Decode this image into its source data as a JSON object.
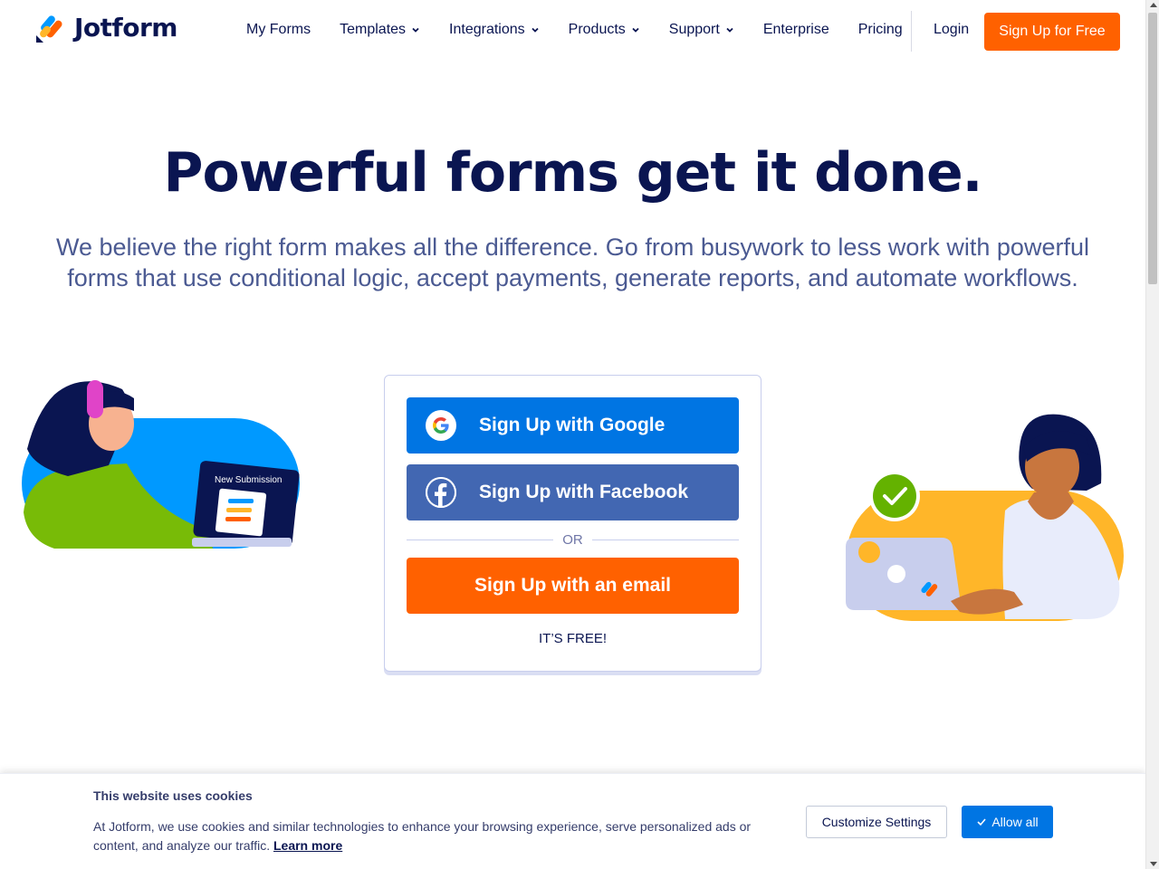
{
  "header": {
    "logo_text": "Jotform",
    "nav": [
      {
        "label": "My Forms",
        "dropdown": false
      },
      {
        "label": "Templates",
        "dropdown": true
      },
      {
        "label": "Integrations",
        "dropdown": true
      },
      {
        "label": "Products",
        "dropdown": true
      },
      {
        "label": "Support",
        "dropdown": true
      },
      {
        "label": "Enterprise",
        "dropdown": false
      },
      {
        "label": "Pricing",
        "dropdown": false
      }
    ],
    "login_label": "Login",
    "signup_label": "Sign Up for Free"
  },
  "hero": {
    "title": "Powerful forms get it done.",
    "subtitle": "We believe the right form makes all the difference. Go from busywork to less work with powerful forms that use conditional logic, accept payments, generate reports, and automate workflows."
  },
  "signup_card": {
    "google_label": "Sign Up with Google",
    "facebook_label": "Sign Up with Facebook",
    "or_label": "OR",
    "email_label": "Sign Up with an email",
    "free_label": "IT’S FREE!"
  },
  "illustration_left": {
    "laptop_text": "New Submission"
  },
  "cookie_banner": {
    "title": "This website uses cookies",
    "text": "At Jotform, we use cookies and similar technologies to enhance your browsing experience, serve personalized ads or content, and analyze our traffic.",
    "learn_more": "Learn more",
    "customize_label": "Customize Settings",
    "allow_label": "Allow all"
  },
  "colors": {
    "brand_orange": "#ff6100",
    "brand_navy": "#0a1551",
    "google_blue": "#0075e3",
    "facebook_blue": "#4267b2"
  }
}
